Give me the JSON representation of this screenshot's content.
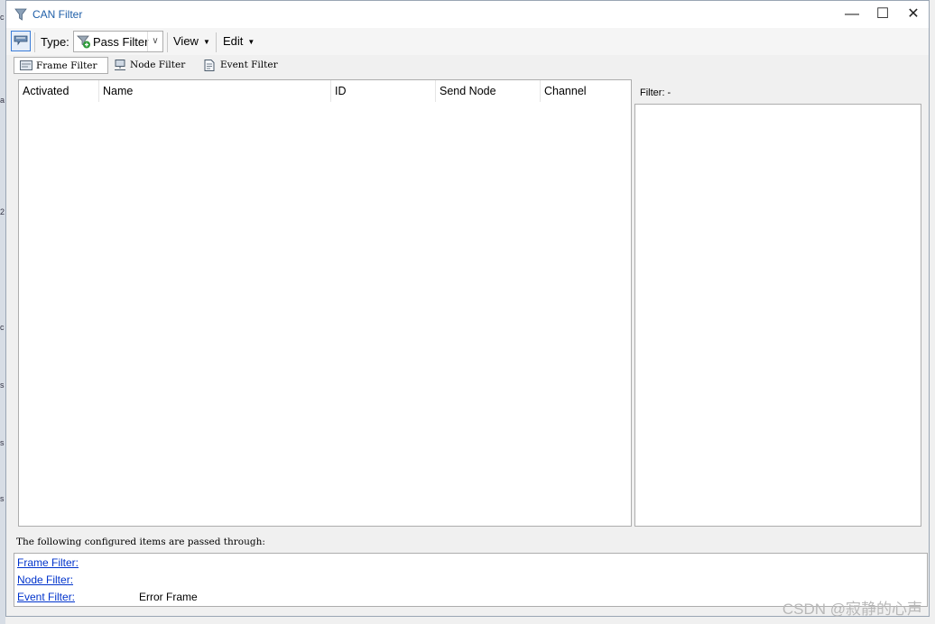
{
  "window": {
    "title": "CAN Filter",
    "minimize_glyph": "—",
    "maximize_glyph": "☐",
    "close_glyph": "✕"
  },
  "toolbar": {
    "type_label": "Type:",
    "type_value": "Pass Filter",
    "view_label": "View",
    "edit_label": "Edit"
  },
  "tabs": [
    {
      "label": "Frame Filter",
      "icon": "frame-icon",
      "active": true
    },
    {
      "label": "Node Filter",
      "icon": "node-icon",
      "active": false
    },
    {
      "label": "Event Filter",
      "icon": "event-icon",
      "active": false
    }
  ],
  "table": {
    "columns": [
      "Activated",
      "Name",
      "ID",
      "Send Node",
      "Channel"
    ],
    "rows": []
  },
  "details": {
    "filter_label": "Filter: -"
  },
  "summary": {
    "intro": "The following configured items are passed through:",
    "items": [
      {
        "label": "Frame Filter:",
        "value": ""
      },
      {
        "label": "Node Filter:",
        "value": ""
      },
      {
        "label": "Event Filter:",
        "value": "Error Frame"
      }
    ]
  },
  "left_edge_glyphs": [
    "c",
    "a",
    "2",
    "c",
    "s",
    "s",
    "s"
  ],
  "watermark": "CSDN @寂静的心声",
  "colors": {
    "accent": "#1f5fa8",
    "link": "#0033cc",
    "border": "#adadad"
  }
}
